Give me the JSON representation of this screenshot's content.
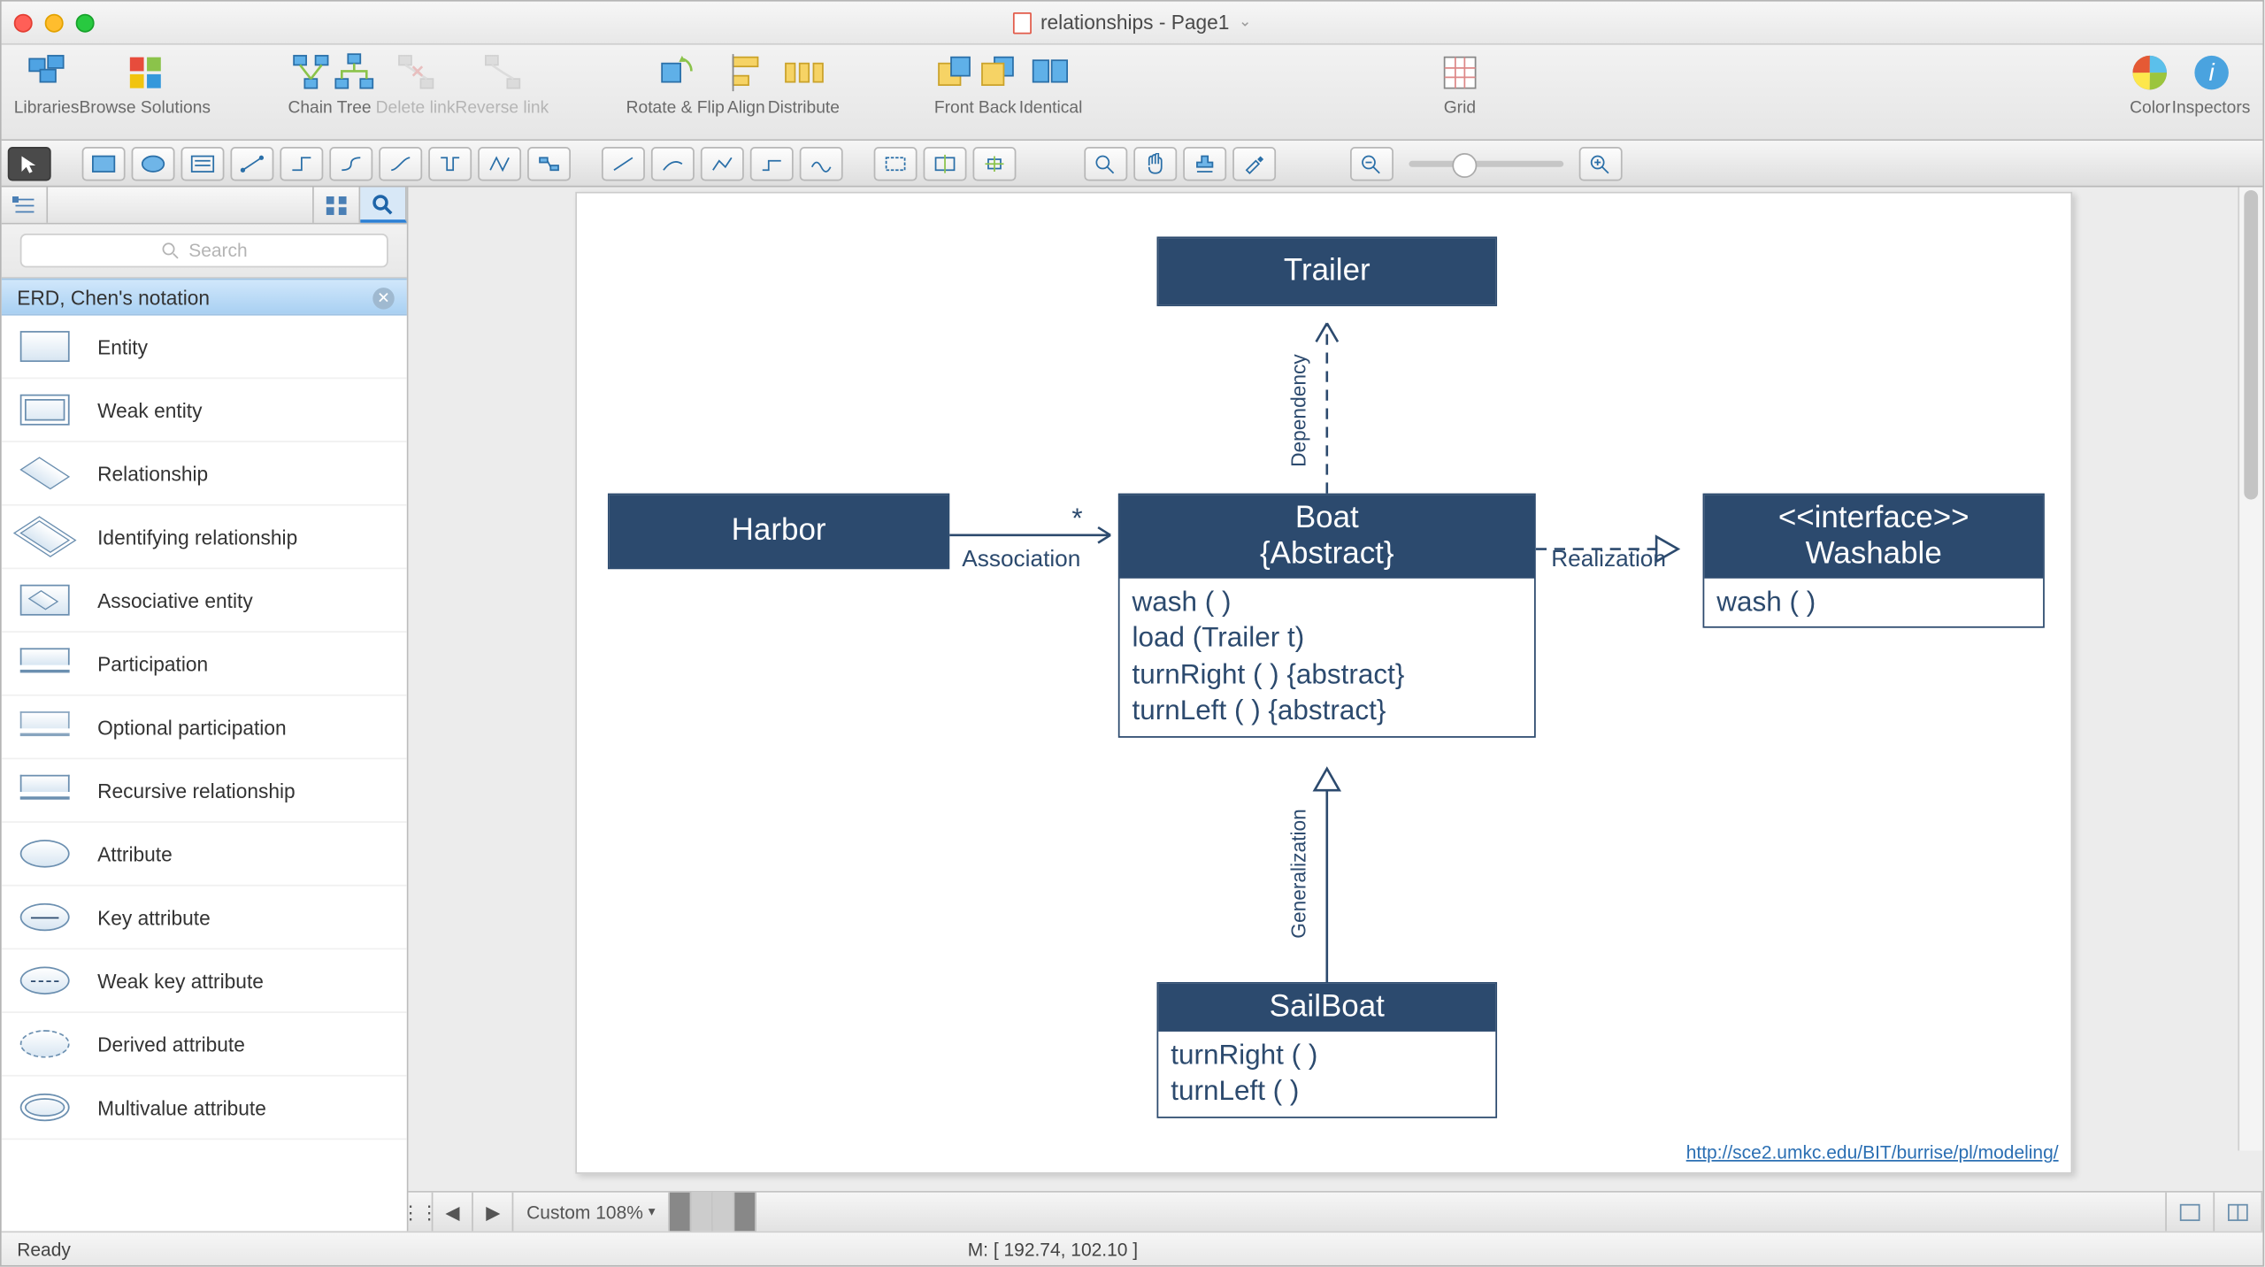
{
  "window": {
    "title": "relationships - Page1"
  },
  "toolbar": {
    "libraries": "Libraries",
    "browse": "Browse Solutions",
    "chain": "Chain",
    "tree": "Tree",
    "delete_link": "Delete link",
    "reverse_link": "Reverse link",
    "rotate_flip": "Rotate & Flip",
    "align": "Align",
    "distribute": "Distribute",
    "front": "Front",
    "back": "Back",
    "identical": "Identical",
    "grid": "Grid",
    "color": "Color",
    "inspectors": "Inspectors"
  },
  "sidebar": {
    "search_placeholder": "Search",
    "category": "ERD, Chen's notation",
    "items": [
      "Entity",
      "Weak entity",
      "Relationship",
      "Identifying relationship",
      "Associative entity",
      "Participation",
      "Optional participation",
      "Recursive relationship",
      "Attribute",
      "Key attribute",
      "Weak key attribute",
      "Derived attribute",
      "Multivalue attribute"
    ]
  },
  "diagram": {
    "trailer": "Trailer",
    "harbor": "Harbor",
    "boat_title_1": "Boat",
    "boat_title_2": "{Abstract}",
    "boat_m1": "wash ( )",
    "boat_m2": "load (Trailer t)",
    "boat_m3": "turnRight ( ) {abstract}",
    "boat_m4": "turnLeft ( ) {abstract}",
    "iface_1": "<<interface>>",
    "iface_2": "Washable",
    "iface_m1": "wash ( )",
    "sail_title": "SailBoat",
    "sail_m1": "turnRight ( )",
    "sail_m2": "turnLeft ( )",
    "assoc": "Association",
    "star": "*",
    "realization": "Realization",
    "dependency": "Dependency",
    "generalization": "Generalization",
    "url": "http://sce2.umkc.edu/BIT/burrise/pl/modeling/"
  },
  "pagebar": {
    "zoom_label": "Custom 108%"
  },
  "status": {
    "ready": "Ready",
    "mouse": "M: [ 192.74, 102.10 ]"
  }
}
